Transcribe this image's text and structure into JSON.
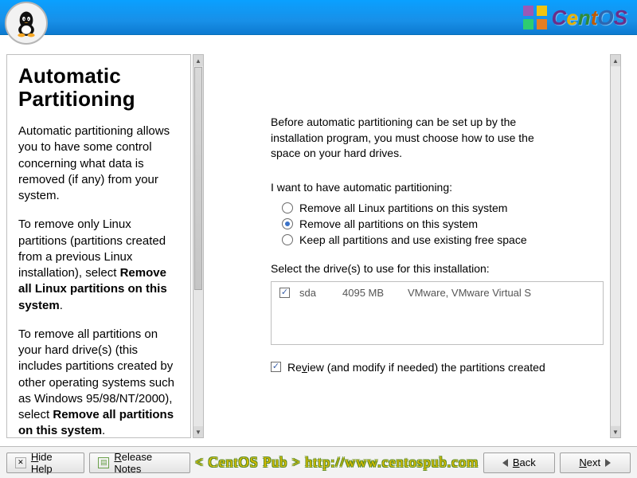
{
  "brand": "CentOS",
  "help": {
    "title": "Automatic Partitioning",
    "p1": "Automatic partitioning allows you to have some control concerning what data is removed (if any) from your system.",
    "p2_pre": "To remove only Linux partitions (partitions created from a previous Linux installation), select ",
    "p2_b": "Remove all Linux partitions on this system",
    "p2_post": ".",
    "p3_pre": "To remove all partitions on your hard drive(s) (this includes partitions created by other operating systems such as Windows 95/98/NT/2000), select ",
    "p3_b": "Remove all partitions on this system",
    "p3_post": "."
  },
  "main": {
    "intro": "Before automatic partitioning can be set up by the installation program, you must choose how to use the space on your hard drives.",
    "radio_label": "I want to have automatic partitioning:",
    "options": [
      "Remove all Linux partitions on this system",
      "Remove all partitions on this system",
      "Keep all partitions and use existing free space"
    ],
    "selected_option": 1,
    "drives_label": "Select the drive(s) to use for this installation:",
    "drives": [
      {
        "checked": true,
        "dev": "sda",
        "size": "4095 MB",
        "model": "VMware, VMware Virtual S"
      }
    ],
    "review_checked": true,
    "review_u": "v",
    "review_pre": "Re",
    "review_post": "iew (and modify if needed) the partitions created"
  },
  "footer": {
    "hide_help_u": "H",
    "hide_help_rest": "ide Help",
    "release_u": "R",
    "release_rest": "elease Notes",
    "back_u": "B",
    "back_rest": "ack",
    "next_u": "N",
    "next_rest": "ext"
  },
  "watermark": "< CentOS Pub >  http://www.centospub.com"
}
